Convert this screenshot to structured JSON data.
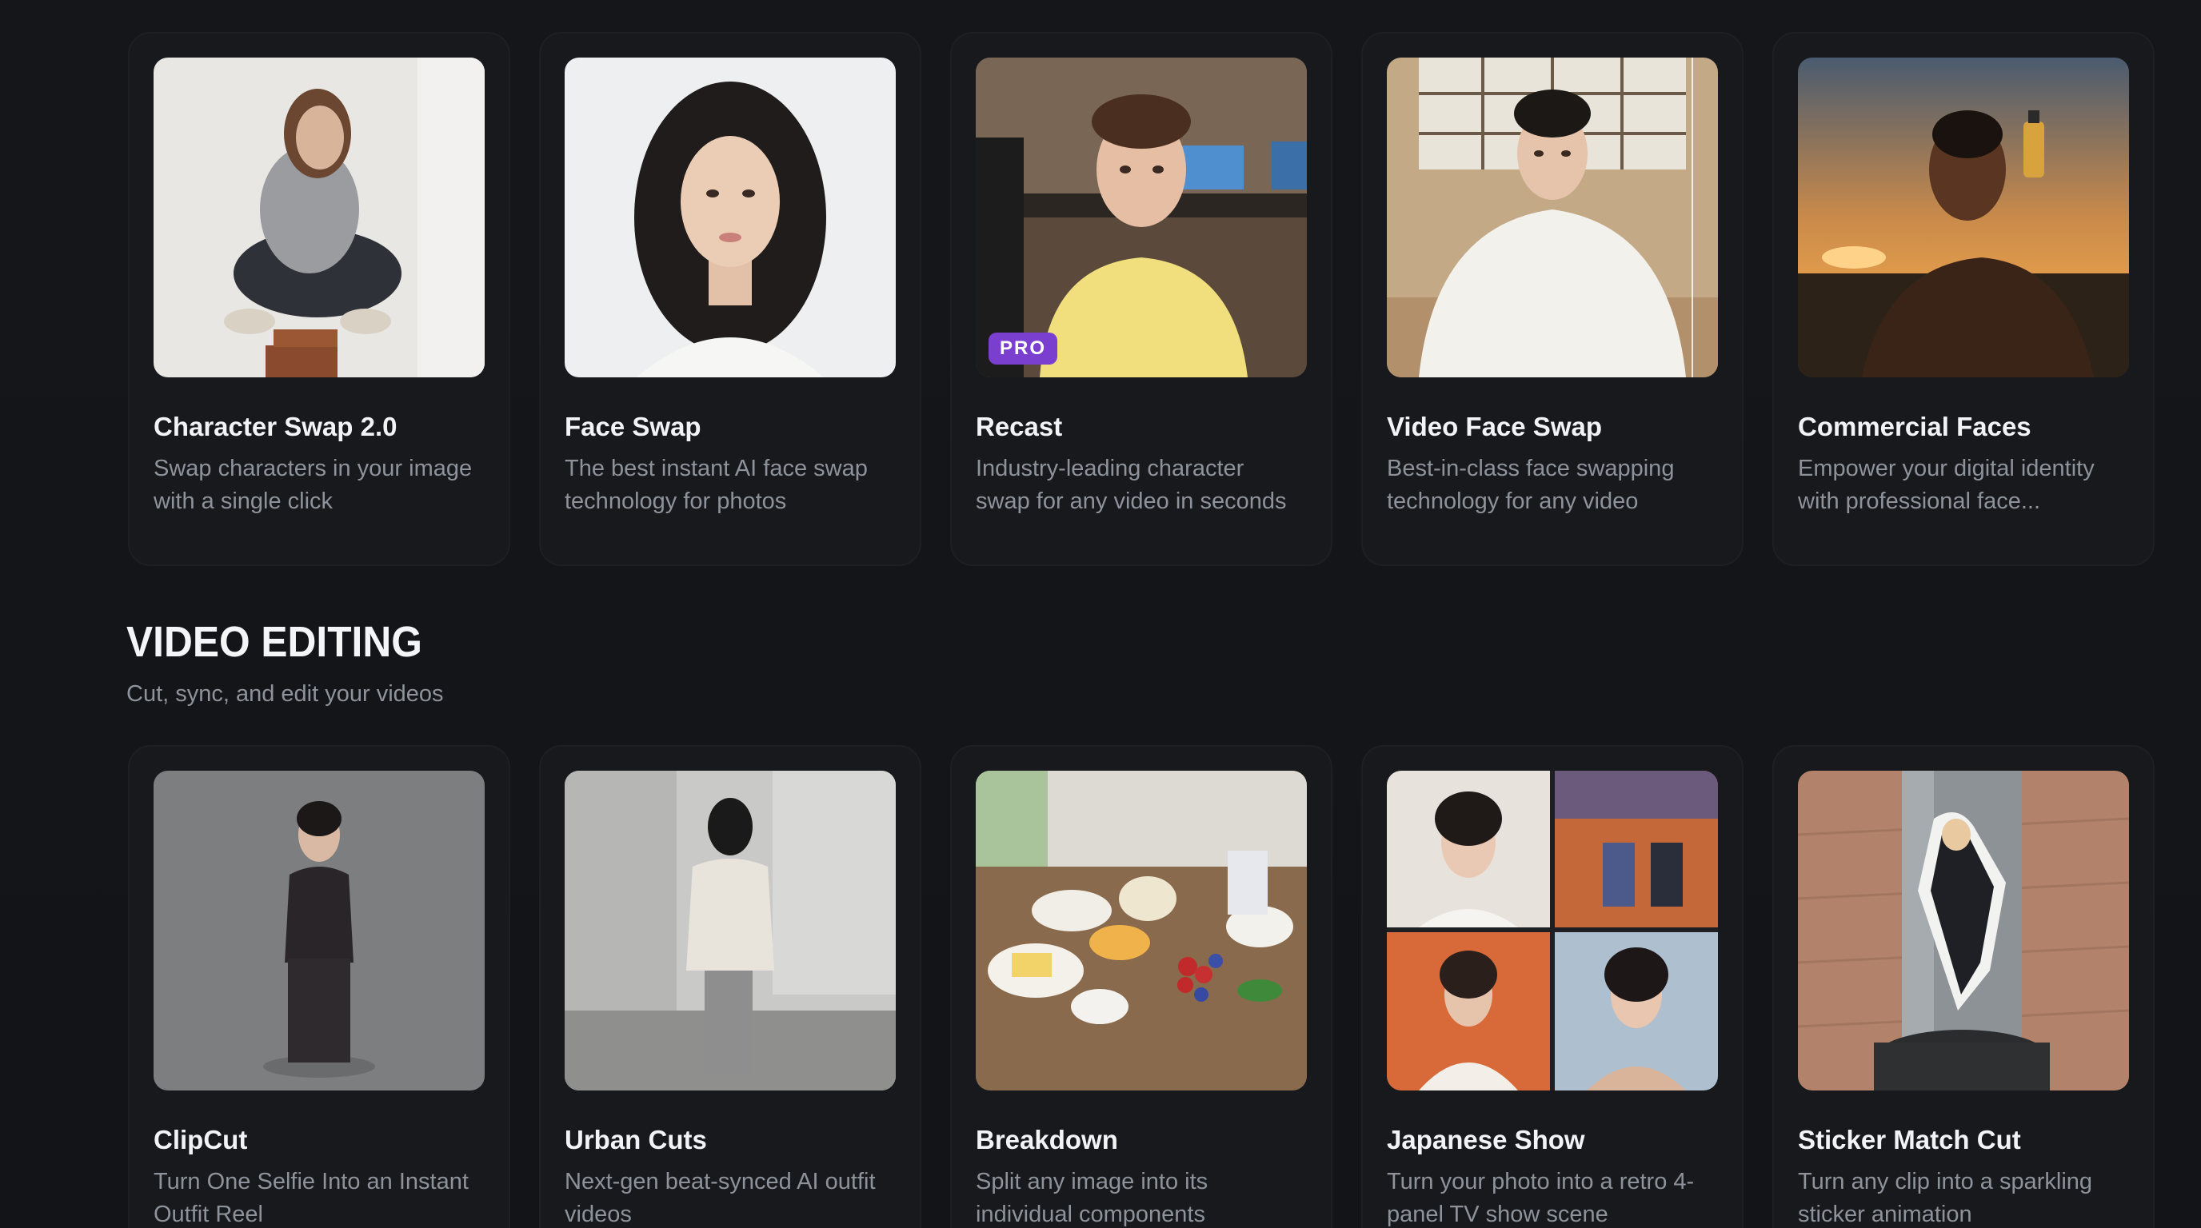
{
  "top_row": [
    {
      "title": "Character Swap 2.0",
      "desc": "Swap characters in your image\nwith a single click"
    },
    {
      "title": "Face Swap",
      "desc": "The best instant AI face swap\ntechnology for photos"
    },
    {
      "title": "Recast",
      "desc": "Industry-leading character\nswap for any video in seconds",
      "badge": "PRO"
    },
    {
      "title": "Video Face Swap",
      "desc": "Best-in-class face swapping\ntechnology for any video"
    },
    {
      "title": "Commercial Faces",
      "desc": "Empower your digital identity\nwith professional face..."
    }
  ],
  "section": {
    "title": "VIDEO EDITING",
    "subtitle": "Cut, sync, and edit your videos"
  },
  "bottom_row": [
    {
      "title": "ClipCut",
      "desc": "Turn One Selfie Into an Instant\nOutfit Reel"
    },
    {
      "title": "Urban Cuts",
      "desc": "Next-gen beat-synced AI outfit\nvideos"
    },
    {
      "title": "Breakdown",
      "desc": "Split any image into its\nindividual components"
    },
    {
      "title": "Japanese Show",
      "desc": "Turn your photo into a retro 4-\npanel TV show scene"
    },
    {
      "title": "Sticker Match Cut",
      "desc": "Turn any clip into a sparkling\nsticker animation"
    }
  ],
  "colors": {
    "background": "#131519",
    "card": "#17191d",
    "badge": "#7b3fd0",
    "muted_text": "#8e939b"
  }
}
